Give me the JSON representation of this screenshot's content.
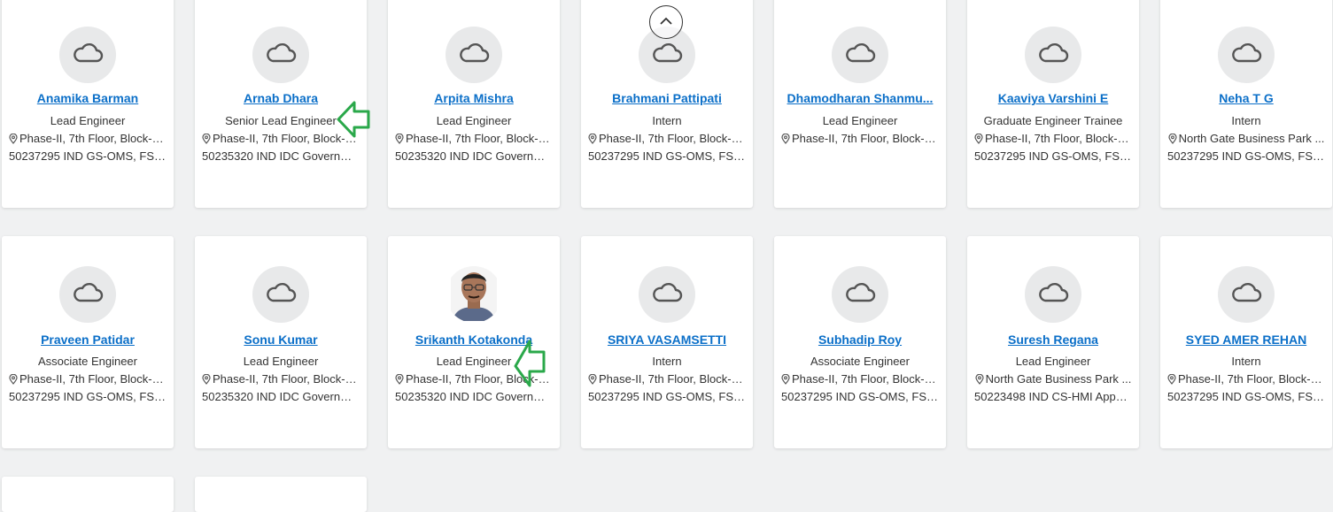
{
  "people": [
    {
      "name": "Anamika Barman",
      "title": "Lead Engineer",
      "location": "Phase-II, 7th Floor, Block-III, ...",
      "org": "50237295 IND GS-OMS, FSW...",
      "photo": false
    },
    {
      "name": "Arnab Dhara",
      "title": "Senior Lead Engineer",
      "location": "Phase-II, 7th Floor, Block-III...",
      "org": "50235320 IND IDC Governme...",
      "photo": false
    },
    {
      "name": "Arpita Mishra",
      "title": "Lead Engineer",
      "location": "Phase-II, 7th Floor, Block-III...",
      "org": "50235320 IND IDC Governme...",
      "photo": false
    },
    {
      "name": "Brahmani Pattipati",
      "title": "Intern",
      "location": "Phase-II, 7th Floor, Block-III...",
      "org": "50237295 IND GS-OMS, FSW...",
      "photo": false
    },
    {
      "name": "Dhamodharan Shanmu...",
      "title": "Lead Engineer",
      "location": "Phase-II, 7th Floor, Block-III...",
      "org": "",
      "photo": false
    },
    {
      "name": "Kaaviya Varshini E",
      "title": "Graduate Engineer Trainee",
      "location": "Phase-II, 7th Floor, Block-III...",
      "org": "50237295 IND GS-OMS, FSW...",
      "photo": false
    },
    {
      "name": "Neha T G",
      "title": "Intern",
      "location": "North Gate Business Park ...",
      "org": "50237295 IND GS-OMS, FSW...",
      "photo": false
    },
    {
      "name": "Praveen Patidar",
      "title": "Associate Engineer",
      "location": "Phase-II, 7th Floor, Block-III...",
      "org": "50237295 IND GS-OMS, FSW...",
      "photo": false
    },
    {
      "name": "Sonu Kumar",
      "title": "Lead Engineer",
      "location": "Phase-II, 7th Floor, Block-III...",
      "org": "50235320 IND IDC Governme...",
      "photo": false
    },
    {
      "name": "Srikanth Kotakonda",
      "title": "Lead Engineer",
      "location": "Phase-II, 7th Floor, Block-III...",
      "org": "50235320 IND IDC Governme...",
      "photo": true
    },
    {
      "name": "SRIYA VASAMSETTI",
      "title": "Intern",
      "location": "Phase-II, 7th Floor, Block-III...",
      "org": "50237295 IND GS-OMS, FSW...",
      "photo": false
    },
    {
      "name": "Subhadip Roy",
      "title": "Associate Engineer",
      "location": "Phase-II, 7th Floor, Block-III...",
      "org": "50237295 IND GS-OMS, FSW...",
      "photo": false
    },
    {
      "name": "Suresh Regana",
      "title": "Lead Engineer",
      "location": "North Gate Business Park ...",
      "org": "50223498 IND CS-HMI Apps ...",
      "photo": false
    },
    {
      "name": "SYED AMER REHAN",
      "title": "Intern",
      "location": "Phase-II, 7th Floor, Block-III...",
      "org": "50237295 IND GS-OMS, FSW...",
      "photo": false
    }
  ],
  "icons": {
    "avatar_placeholder": "cloud-icon",
    "location": "map-pin-icon",
    "scroll_top": "chevron-up-icon",
    "highlight": "green-arrow-icon"
  },
  "colors": {
    "name_link": "#0b6fc8",
    "background": "#f0f1f2",
    "arrow": "#2aa84a"
  }
}
